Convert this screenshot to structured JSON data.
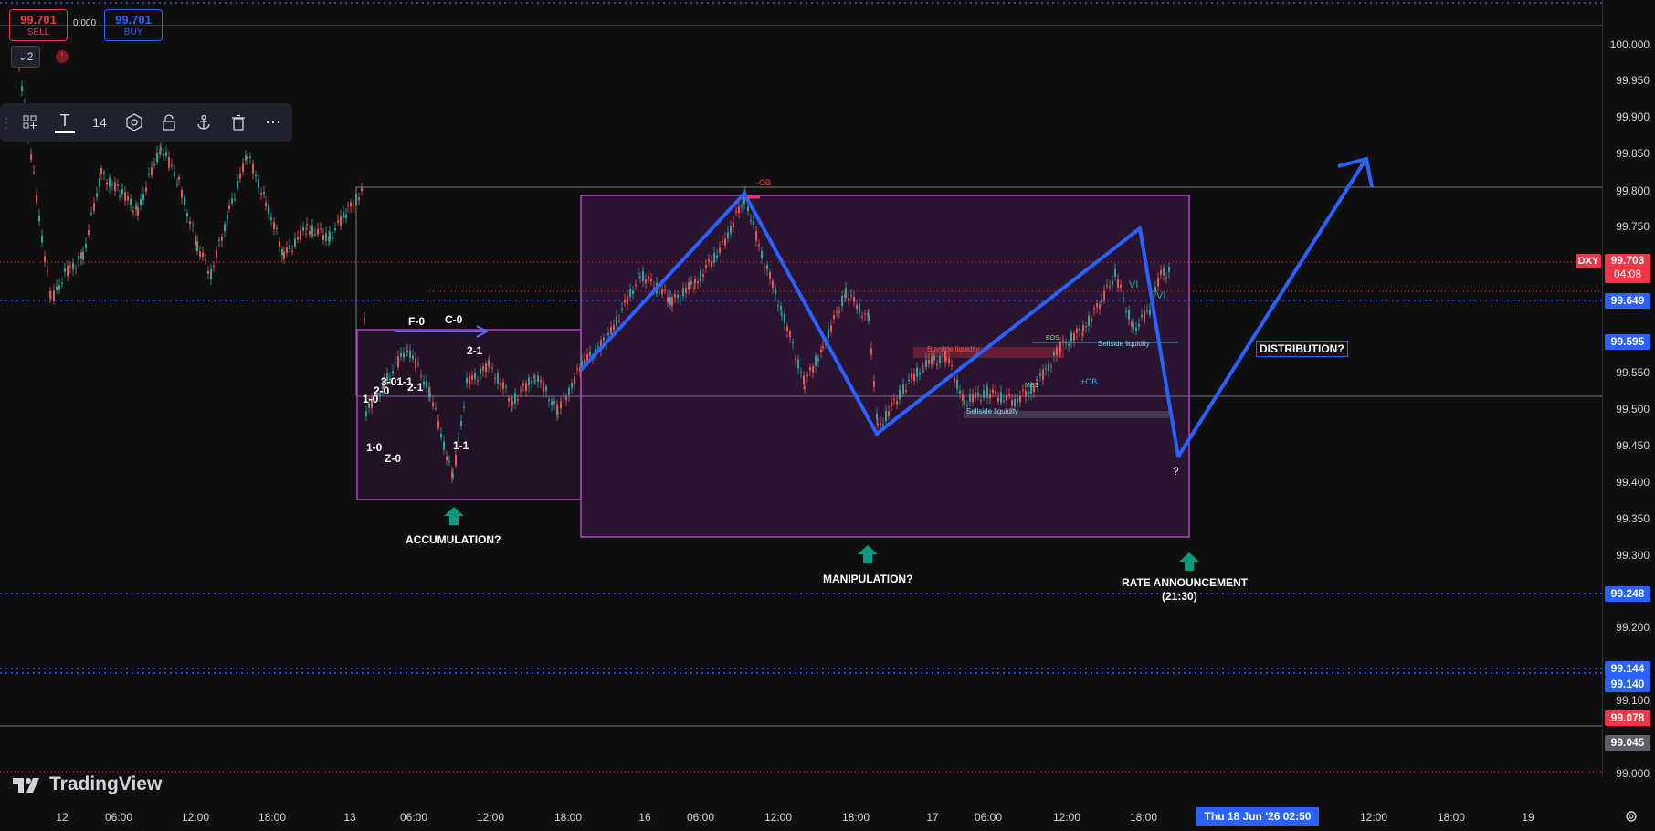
{
  "trade": {
    "sell_price": "99.701",
    "sell_label": "SELL",
    "spread": "0.000",
    "buy_price": "99.701",
    "buy_label": "BUY",
    "indicator_count": "2",
    "alert_symbol": "!"
  },
  "toolbar": {
    "font_size": "14"
  },
  "price_axis": {
    "ticks": [
      "100.000",
      "99.950",
      "99.900",
      "99.850",
      "99.800",
      "99.750",
      "99.550",
      "99.500",
      "99.450",
      "99.400",
      "99.350",
      "99.300",
      "99.200",
      "99.100",
      "99.000"
    ],
    "symbol": "DXY",
    "current_price": "99.703",
    "countdown": "04:08",
    "level_1": "99.649",
    "level_2": "99.595",
    "level_3": "99.248",
    "level_4": "99.144",
    "level_5": "99.140",
    "level_6": "99.078",
    "level_7": "99.045",
    "colors": {
      "current": "#f23645",
      "blue": "#2962ff",
      "red": "#f23645",
      "gray": "#5d606b"
    }
  },
  "time_axis": {
    "ticks": [
      "12",
      "06:00",
      "12:00",
      "18:00",
      "13",
      "06:00",
      "12:00",
      "18:00",
      "16",
      "06:00",
      "12:00",
      "18:00",
      "17",
      "06:00",
      "12:00",
      "18:00",
      "12:00",
      "18:00",
      "19"
    ],
    "crosshair": "Thu 18 Jun '26   02:50"
  },
  "annotations": {
    "accumulation": "ACCUMULATION?",
    "manipulation": "MANIPULATION?",
    "rate_announcement": "RATE ANNOUNCEMENT",
    "rate_time": "(21:30)",
    "distribution": "DISTRIBUTION?",
    "question": "?",
    "f0": "F-0",
    "c0": "C-0",
    "w21a": "2-1",
    "w10": "1-0",
    "w20": "2-0",
    "w3011": "3-01-1",
    "w21b": "2-1",
    "w10b": "1-0",
    "wz0": "Z-0",
    "w11": "1-1",
    "ob_top": "-OB",
    "ob_bottom": "+OB",
    "bos": "BOS",
    "mss": "MSS",
    "sellside1": "Sellside liquidity",
    "sellside2": "Sellside liquidity",
    "buyside": "Buyside liquidity",
    "vi1": "VI",
    "vi2": "VI"
  },
  "branding": {
    "name": "TradingView"
  }
}
